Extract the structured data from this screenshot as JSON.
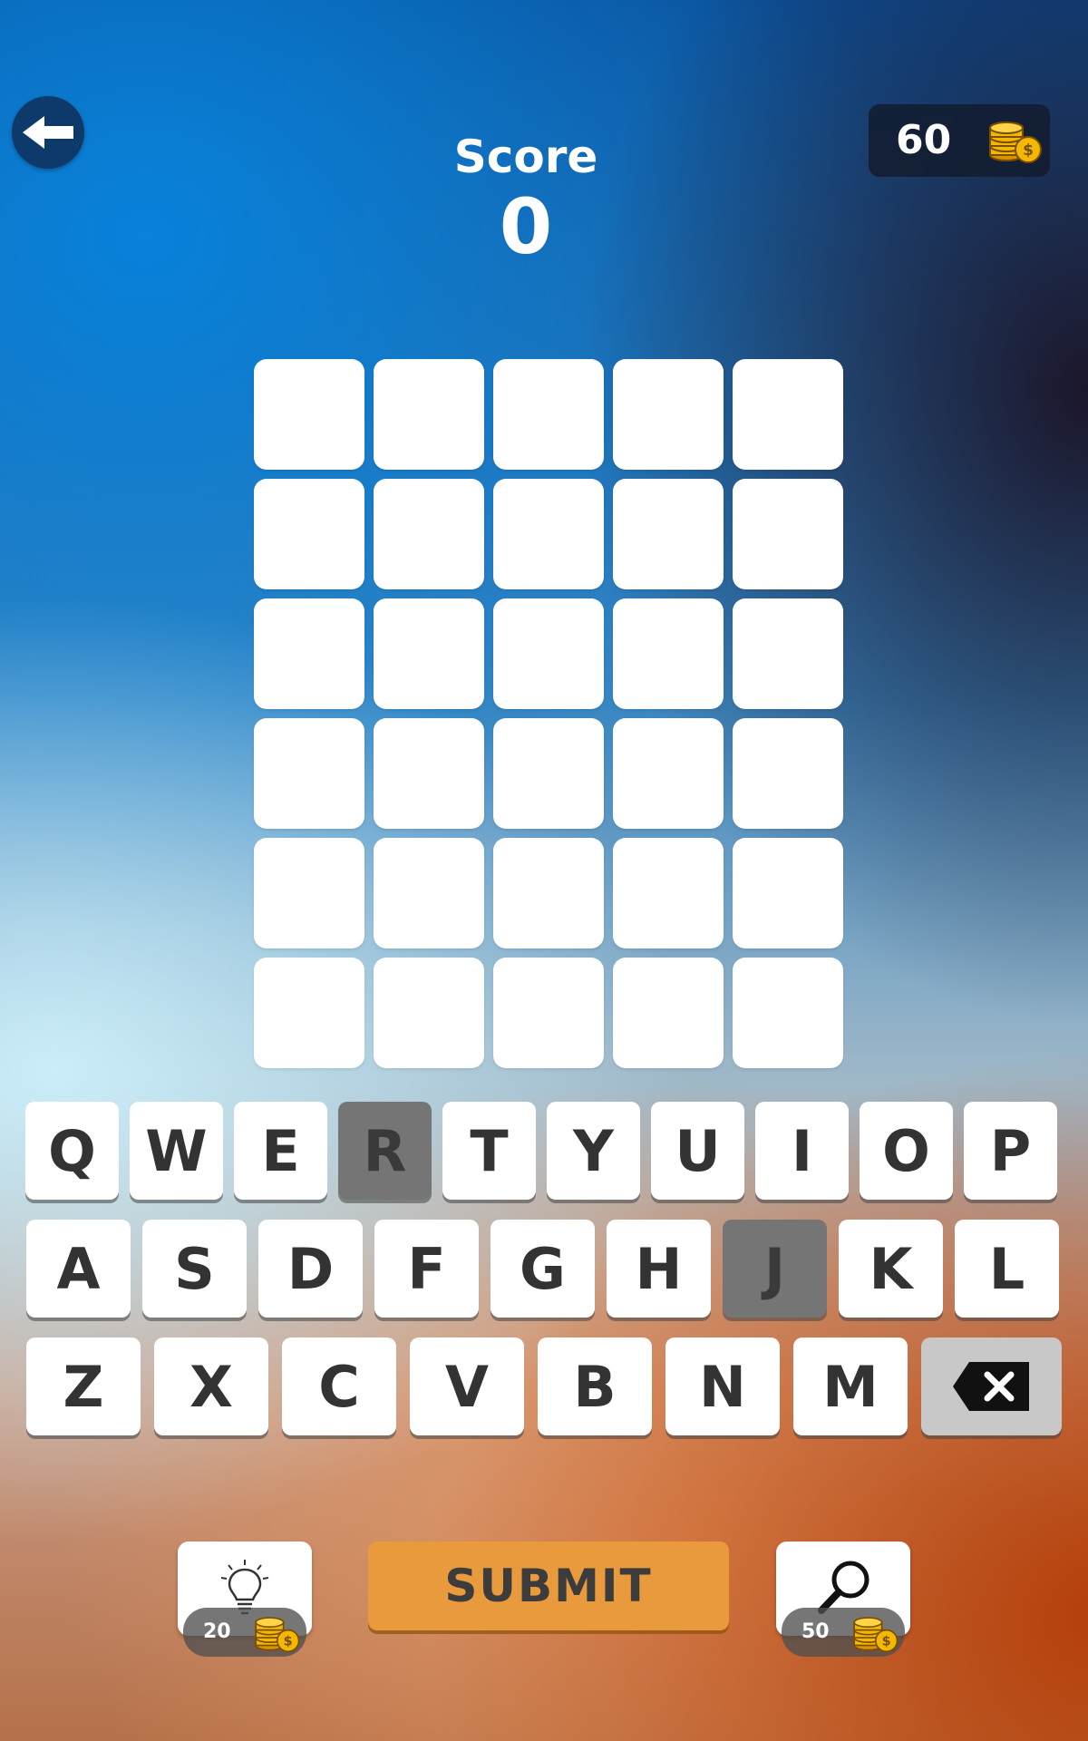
{
  "header": {
    "back_icon": "arrow-left-icon",
    "score_label": "Score",
    "score_value": "0",
    "coins": "60",
    "coin_icon": "coin-stack-icon"
  },
  "board": {
    "rows": 6,
    "cols": 5
  },
  "keyboard": {
    "rows": [
      [
        "Q",
        "W",
        "E",
        "R",
        "T",
        "Y",
        "U",
        "I",
        "O",
        "P"
      ],
      [
        "A",
        "S",
        "D",
        "F",
        "G",
        "H",
        "J",
        "K",
        "L"
      ],
      [
        "Z",
        "X",
        "C",
        "V",
        "B",
        "N",
        "M"
      ]
    ],
    "used_letters": [
      "R",
      "J"
    ],
    "backspace_icon": "backspace-icon"
  },
  "actions": {
    "hint": {
      "icon": "lightbulb-icon",
      "cost": "20"
    },
    "submit_label": "SUBMIT",
    "reveal": {
      "icon": "magnifier-icon",
      "cost": "50"
    }
  },
  "colors": {
    "tile": "#ffffff",
    "used_key": "#757575",
    "submit": "#e89a3c",
    "coin_gold": "#f5b800"
  }
}
